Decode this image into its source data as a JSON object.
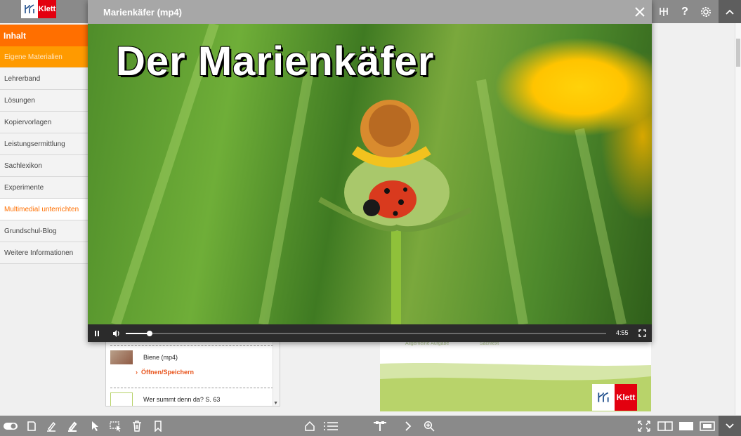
{
  "header": {
    "logo_text": "Klett"
  },
  "sidebar": {
    "heading": "Inhalt",
    "items": [
      {
        "label": "Eigene Materialien",
        "state": "sub"
      },
      {
        "label": "Lehrerband",
        "state": "normal"
      },
      {
        "label": "Lösungen",
        "state": "normal"
      },
      {
        "label": "Kopiervorlagen",
        "state": "normal"
      },
      {
        "label": "Leistungsermittlung",
        "state": "normal"
      },
      {
        "label": "Sachlexikon",
        "state": "normal"
      },
      {
        "label": "Experimente",
        "state": "normal"
      },
      {
        "label": "Multimedial unterrichten",
        "state": "active"
      },
      {
        "label": "Grundschul-Blog",
        "state": "normal"
      },
      {
        "label": "Weitere Informationen",
        "state": "normal"
      }
    ]
  },
  "modal": {
    "title": "Marienkäfer (mp4)",
    "video_title": "Der Marienkäfer",
    "time_remaining": "4:55",
    "progress_fraction": 0.05
  },
  "media_list": {
    "items": [
      {
        "title": "Biene (mp4)",
        "action": "Öffnen/Speichern"
      },
      {
        "title": "Wer summt denn da? S. 63"
      }
    ]
  },
  "page_preview": {
    "text_left": "Allgemeine Aufgabe",
    "text_right": "Sachtext",
    "logo_text": "Klett"
  },
  "colors": {
    "accent_orange": "#ff6f00",
    "sub_orange": "#ff9a00",
    "toolbar_gray": "#8a8a8a",
    "klett_red": "#e3000f"
  }
}
